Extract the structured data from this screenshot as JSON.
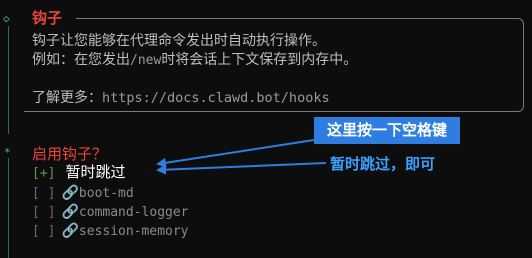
{
  "hooks_box": {
    "title": "钩子",
    "line1": "钩子让您能够在代理命令发出时自动执行操作。",
    "line2_prefix": "例如：在您发出",
    "line2_command": "/new",
    "line2_suffix": "时将会话上下文保存到内存中。",
    "learn_more_label": "了解更多：",
    "learn_more_url": "https://docs.clawd.bot/hooks"
  },
  "prompt": {
    "question": "启用钩子？",
    "options": [
      {
        "check": "[+]",
        "label": "暂时跳过",
        "selected": true
      },
      {
        "check": "[ ]",
        "icon": "link-icon",
        "label": "boot-md",
        "selected": false
      },
      {
        "check": "[ ]",
        "icon": "link-icon",
        "label": "command-logger",
        "selected": false
      },
      {
        "check": "[ ]",
        "icon": "link-icon",
        "label": "session-memory",
        "selected": false
      }
    ]
  },
  "annotations": {
    "press_space": "这里按一下空格键",
    "skip_note": "暂时跳过，即可"
  },
  "colors": {
    "background": "#0d0d0d",
    "title_red": "#e8453c",
    "gutter_green": "#4bb39a",
    "annotation_blue": "#2f7de0",
    "annotation_text_blue": "#3aa0ff"
  }
}
